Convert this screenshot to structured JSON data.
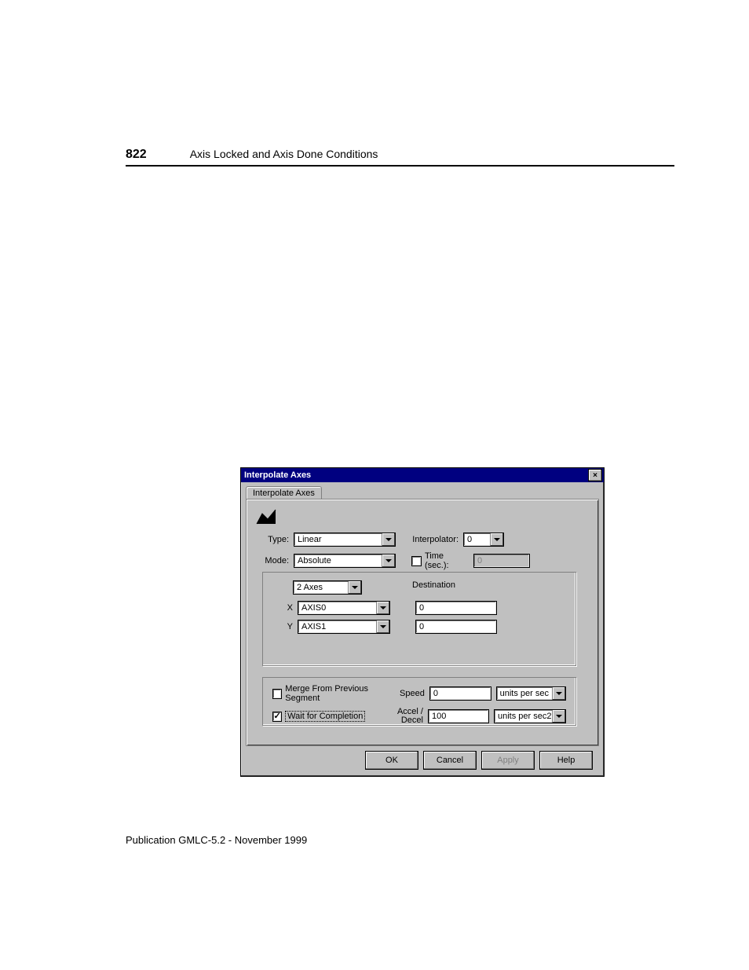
{
  "header": {
    "page_number": "822",
    "section_title": "Axis Locked and Axis Done Conditions"
  },
  "footer": {
    "publication": "Publication GMLC-5.2 - November 1999"
  },
  "dialog": {
    "title": "Interpolate Axes",
    "tab_label": "Interpolate Axes",
    "type": {
      "label": "Type:",
      "value": "Linear"
    },
    "mode": {
      "label": "Mode:",
      "value": "Absolute"
    },
    "interpolator": {
      "label": "Interpolator:",
      "value": "0"
    },
    "time": {
      "label": "Time (sec.):",
      "value": "0",
      "checked": false
    },
    "axes_count": {
      "value": "2 Axes"
    },
    "destination_header": "Destination",
    "axes": {
      "x": {
        "label": "X",
        "value": "AXIS0",
        "dest": "0"
      },
      "y": {
        "label": "Y",
        "value": "AXIS1",
        "dest": "0"
      }
    },
    "merge": {
      "label": "Merge From Previous Segment",
      "checked": false
    },
    "wait": {
      "label": "Wait for Completion",
      "checked": true
    },
    "speed": {
      "label": "Speed",
      "value": "0",
      "units": "units per sec"
    },
    "accel": {
      "label": "Accel / Decel",
      "value": "100",
      "units": "units per sec2"
    },
    "buttons": {
      "ok": "OK",
      "cancel": "Cancel",
      "apply": "Apply",
      "help": "Help"
    }
  }
}
